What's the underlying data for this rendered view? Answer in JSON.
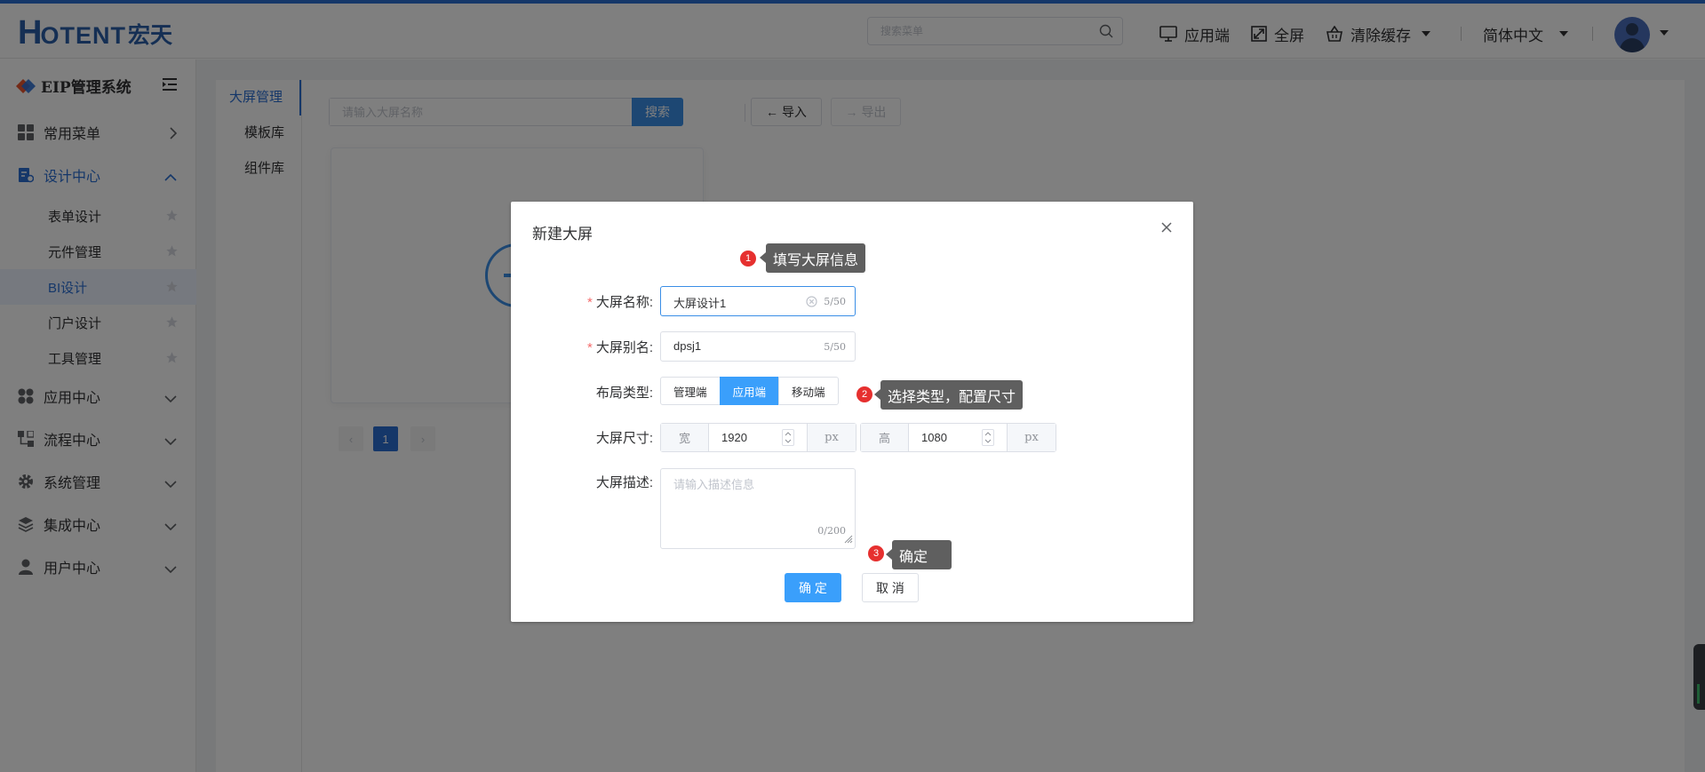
{
  "header": {
    "logo_big": "H",
    "logo_rest": "OTENT",
    "logo_cn": "宏天",
    "search_placeholder": "搜索菜单",
    "app_label": "应用端",
    "fullscreen_label": "全屏",
    "clear_cache_label": "清除缓存",
    "language_label": "简体中文"
  },
  "sidebar": {
    "system_title": "EIP管理系统",
    "menu": [
      {
        "label": "常用菜单",
        "icon": "grid-icon",
        "expanded": false
      },
      {
        "label": "设计中心",
        "icon": "design-doc-icon",
        "expanded": true,
        "active": true
      },
      {
        "label": "应用中心",
        "icon": "app-icon",
        "expanded": false
      },
      {
        "label": "流程中心",
        "icon": "flow-icon",
        "expanded": false
      },
      {
        "label": "系统管理",
        "icon": "gear-icon",
        "expanded": false
      },
      {
        "label": "集成中心",
        "icon": "layers-icon",
        "expanded": false
      },
      {
        "label": "用户中心",
        "icon": "user-icon",
        "expanded": false
      }
    ],
    "design_sub": [
      {
        "label": "表单设计"
      },
      {
        "label": "元件管理"
      },
      {
        "label": "BI设计",
        "active": true
      },
      {
        "label": "门户设计"
      },
      {
        "label": "工具管理"
      }
    ]
  },
  "subnav": {
    "tabs": [
      "大屏管理",
      "模板库",
      "组件库"
    ],
    "active": "大屏管理"
  },
  "main": {
    "search_placeholder": "请输入大屏名称",
    "search_button": "搜索",
    "import_button": "导入",
    "export_button": "导出",
    "pagination": {
      "current": "1",
      "prev": "‹",
      "next": "›"
    }
  },
  "dialog": {
    "title": "新建大屏",
    "fields": {
      "name_label": "大屏名称:",
      "name_value": "大屏设计1",
      "name_count": "5/50",
      "alias_label": "大屏别名:",
      "alias_value": "dpsj1",
      "alias_count": "5/50",
      "layout_label": "布局类型:",
      "layout_options": [
        "管理端",
        "应用端",
        "移动端"
      ],
      "layout_selected": "应用端",
      "size_label": "大屏尺寸:",
      "width_prefix": "宽",
      "width_value": "1920",
      "width_unit": "px",
      "height_prefix": "高",
      "height_value": "1080",
      "height_unit": "px",
      "desc_label": "大屏描述:",
      "desc_placeholder": "请输入描述信息",
      "desc_count": "0/200"
    },
    "ok_button": "确 定",
    "cancel_button": "取 消"
  },
  "tips": [
    {
      "num": "1",
      "text": "填写大屏信息"
    },
    {
      "num": "2",
      "text": "选择类型，配置尺寸"
    },
    {
      "num": "3",
      "text": "确定"
    }
  ],
  "colors": {
    "primary": "#3a9ffb",
    "brand": "#2b6ed3",
    "badge": "#e6302f",
    "tip_bg": "#5f5f5f"
  }
}
